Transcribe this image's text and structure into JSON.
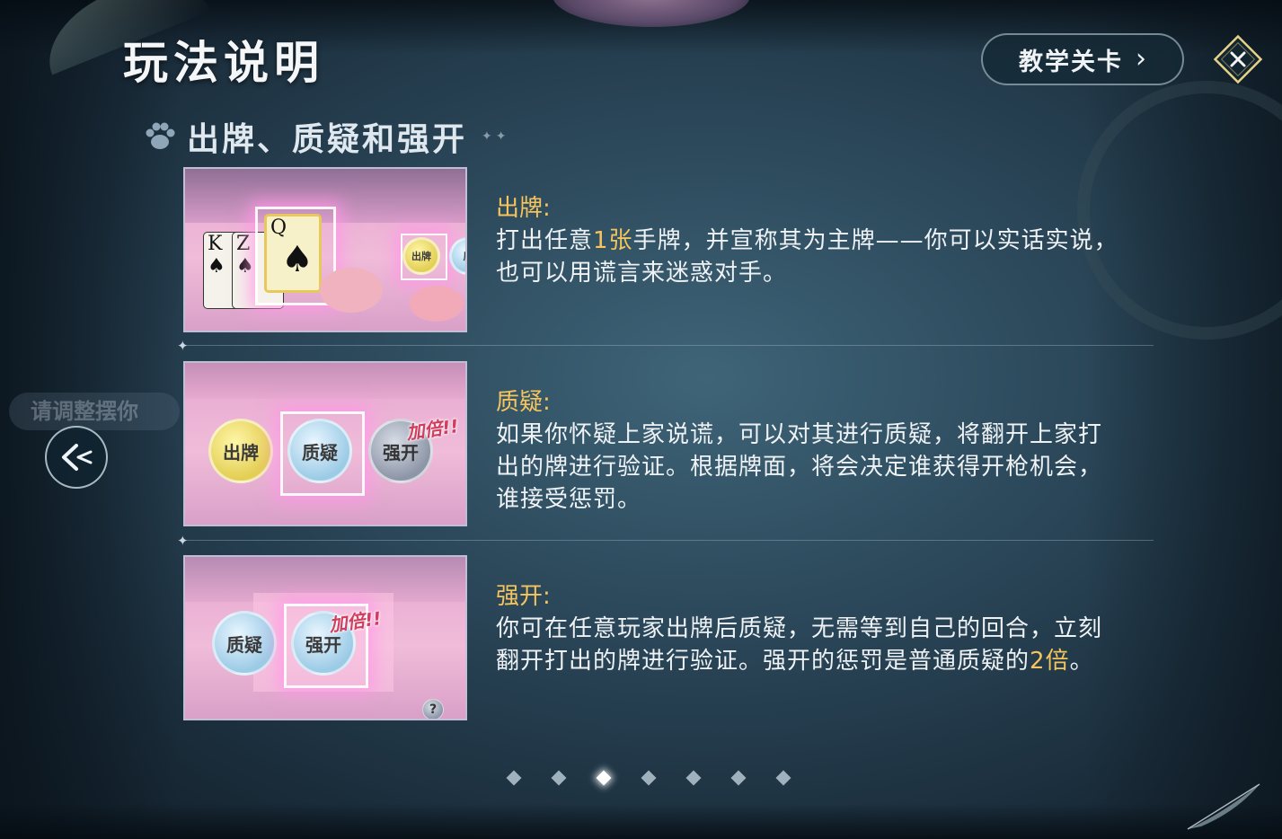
{
  "header": {
    "title": "玩法说明",
    "tutorial_button": "教学关卡"
  },
  "side_hint": "请调整摆你",
  "section": {
    "title": "出牌、质疑和强开"
  },
  "rows": [
    {
      "title": "出牌:",
      "body_parts": [
        "打出任意",
        "1张",
        "手牌，并宣称其为主牌——你可以实话实说，也可以用谎言来迷惑对手。"
      ],
      "thumb": {
        "cards": [
          "K",
          "Z",
          "Q"
        ],
        "chip_labels": [
          "出牌",
          "质"
        ]
      }
    },
    {
      "title": "质疑:",
      "body_parts": [
        "如果你怀疑上家说谎，可以对其进行质疑，将翻开上家打出的牌进行验证。根据牌面，将会决定谁获得开枪机会，谁接受惩罚。"
      ],
      "thumb": {
        "chip_labels": [
          "出牌",
          "质疑",
          "强开"
        ],
        "double_tag": "加倍!!"
      }
    },
    {
      "title": "强开:",
      "body_parts": [
        "你可在任意玩家出牌后质疑，无需等到自己的回合，立刻翻开打出的牌进行验证。强开的惩罚是普通质疑的",
        "2倍",
        "。"
      ],
      "thumb": {
        "chip_labels": [
          "质疑",
          "强开"
        ],
        "double_tag": "加倍!!",
        "help_mark": "?"
      }
    }
  ],
  "pager": {
    "total": 7,
    "current": 3
  },
  "colors": {
    "highlight": "#f5c45c",
    "text": "#eef2f5",
    "background": "#2a4658"
  },
  "icons": {
    "close": "close-icon",
    "tutorial_arrow": "chevron-right-icon",
    "prev": "arrow-left-icon",
    "section": "paw-icon"
  }
}
